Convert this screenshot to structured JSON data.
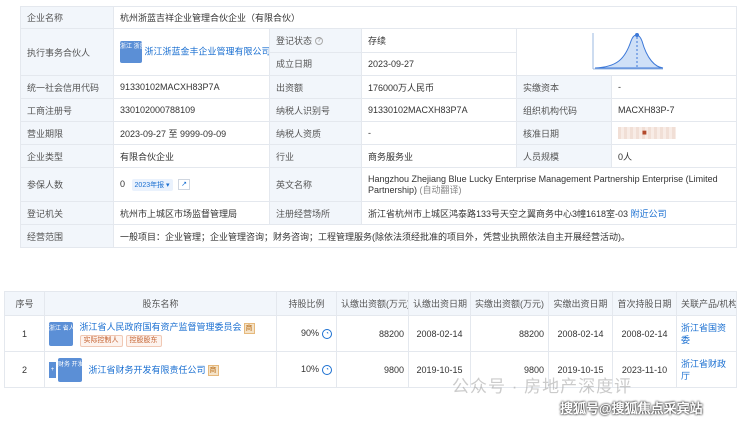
{
  "info": {
    "company_name_label": "企业名称",
    "company_name": "杭州浙蓝吉祥企业管理合伙企业（有限合伙）",
    "partner_label": "执行事务合伙人",
    "partner_logo": "浙江 浙蓝",
    "partner_name": "浙江浙蓝金丰企业管理有限公司",
    "reg_status_label": "登记状态",
    "reg_status": "存续",
    "est_date_label": "成立日期",
    "est_date": "2023-09-27",
    "credit_code_label": "统一社会信用代码",
    "credit_code": "91330102MACXH83P7A",
    "capital_label": "出资额",
    "capital": "176000万人民币",
    "paid_capital_label": "实缴资本",
    "paid_capital": "-",
    "reg_no_label": "工商注册号",
    "reg_no": "330102000788109",
    "taxpayer_id_label": "纳税人识别号",
    "taxpayer_id": "91330102MACXH83P7A",
    "org_code_label": "组织机构代码",
    "org_code": "MACXH83P-7",
    "term_label": "营业期限",
    "term": "2023-09-27 至 9999-09-09",
    "taxpayer_qual_label": "纳税人资质",
    "taxpayer_qual": "-",
    "approve_date_label": "核准日期",
    "type_label": "企业类型",
    "type": "有限合伙企业",
    "industry_label": "行业",
    "industry": "商务服务业",
    "staff_label": "人员规模",
    "staff": "0人",
    "insured_label": "参保人数",
    "insured": "0",
    "insured_year": "2023年报",
    "eng_name_label": "英文名称",
    "eng_name": "Hangzhou Zhejiang Blue Lucky Enterprise Management Partnership Enterprise (Limited Partnership)",
    "eng_name_note": "(自动翻译)",
    "authority_label": "登记机关",
    "authority": "杭州市上城区市场监督管理局",
    "address_label": "注册经营场所",
    "address": "浙江省杭州市上城区鸿泰路133号天空之翼商务中心3幢1618室-03",
    "nearby_link": "附近公司",
    "scope_label": "经营范围",
    "scope": "一般项目：企业管理；企业管理咨询；财务咨询；工程管理服务(除依法须经批准的项目外，凭营业执照依法自主开展经营活动)。"
  },
  "shareholders": {
    "headers": [
      "序号",
      "股东名称",
      "持股比例",
      "认缴出资额(万元)",
      "认缴出资日期",
      "实缴出资额(万元)",
      "实缴出资日期",
      "首次持股日期",
      "关联产品/机构"
    ],
    "rows": [
      {
        "index": "1",
        "logo": "浙江 省人",
        "name": "浙江省人民政府国有资产监督管理委员会",
        "tags": [
          "实际控制人",
          "控股股东"
        ],
        "ratio": "90%",
        "sub_amount": "88200",
        "sub_date": "2008-02-14",
        "paid_amount": "88200",
        "paid_date": "2008-02-14",
        "first_date": "2008-02-14",
        "related": "浙江省国资委"
      },
      {
        "index": "2",
        "logo": "财务 开发",
        "name": "浙江省财务开发有限责任公司",
        "tags": [],
        "ratio": "10%",
        "sub_amount": "9800",
        "sub_date": "2019-10-15",
        "paid_amount": "9800",
        "paid_date": "2019-10-15",
        "first_date": "2023-11-10",
        "related": "浙江省财政厅"
      }
    ]
  },
  "watermarks": {
    "wm1": "公众号 · 房地产深度评",
    "wm2": "搜狐号@搜狐焦点采宾站"
  },
  "colors": {
    "label_bg": "#f2f6fb",
    "link": "#1a6fd1",
    "border": "#e4e8ee",
    "status_green": "#2e9b3f"
  }
}
